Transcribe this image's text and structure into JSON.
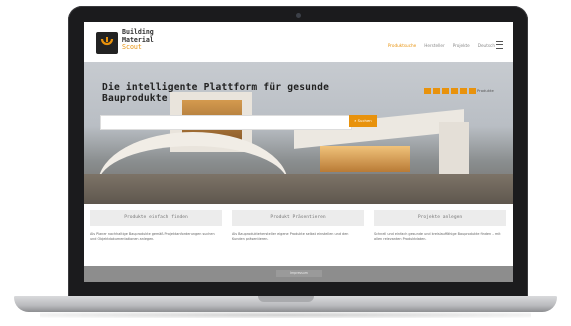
{
  "logo": {
    "line1": "Building",
    "line2": "Material",
    "line3": "Scout"
  },
  "nav": {
    "items": [
      "Produktsuche",
      "Hersteller",
      "Projekte",
      "Deutsch"
    ],
    "active_index": 0
  },
  "hero": {
    "title": "Die intelligente Plattform für gesunde Bauprodukte",
    "search_value": "",
    "search_button": "Suchen",
    "badge_label": "Produkte"
  },
  "features": [
    {
      "title": "Produkte einfach finden",
      "text": "Als Planer nachhaltige Bauprodukte gemäß Projektanforderungen suchen und Objektdokumentationen anlegen."
    },
    {
      "title": "Produkt Präsentieren",
      "text": "Als Bauproduktehersteller eigene Produkte selbst einstellen und den Kunden präsentieren."
    },
    {
      "title": "Projekte anlegen",
      "text": "Schnell und einfach gesunde und kreislauffähige Bauprodukte finden – mit allen relevanten Produktdaten."
    }
  ],
  "footer": {
    "button": "Impressum"
  },
  "colors": {
    "accent": "#e8920c",
    "laptop_bezel": "#1b1b1d"
  }
}
